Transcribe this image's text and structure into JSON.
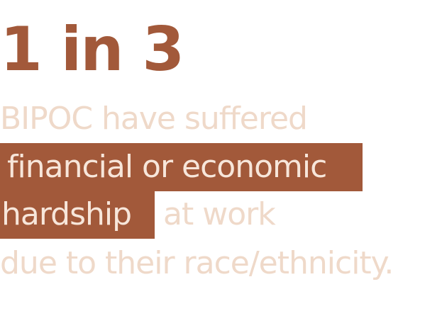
{
  "stat": {
    "value": "1 in 3"
  },
  "statement": {
    "line1": "BIPOC have suffered",
    "highlight1": "financial or economic",
    "highlight2": "hardship",
    "line3_rest": "at work",
    "line4": "due to their race/ethnicity."
  },
  "colors": {
    "accent": "#a2593a",
    "muted_text": "#efd9c9",
    "highlight_text": "#f7e6da",
    "background": "#ffffff"
  }
}
